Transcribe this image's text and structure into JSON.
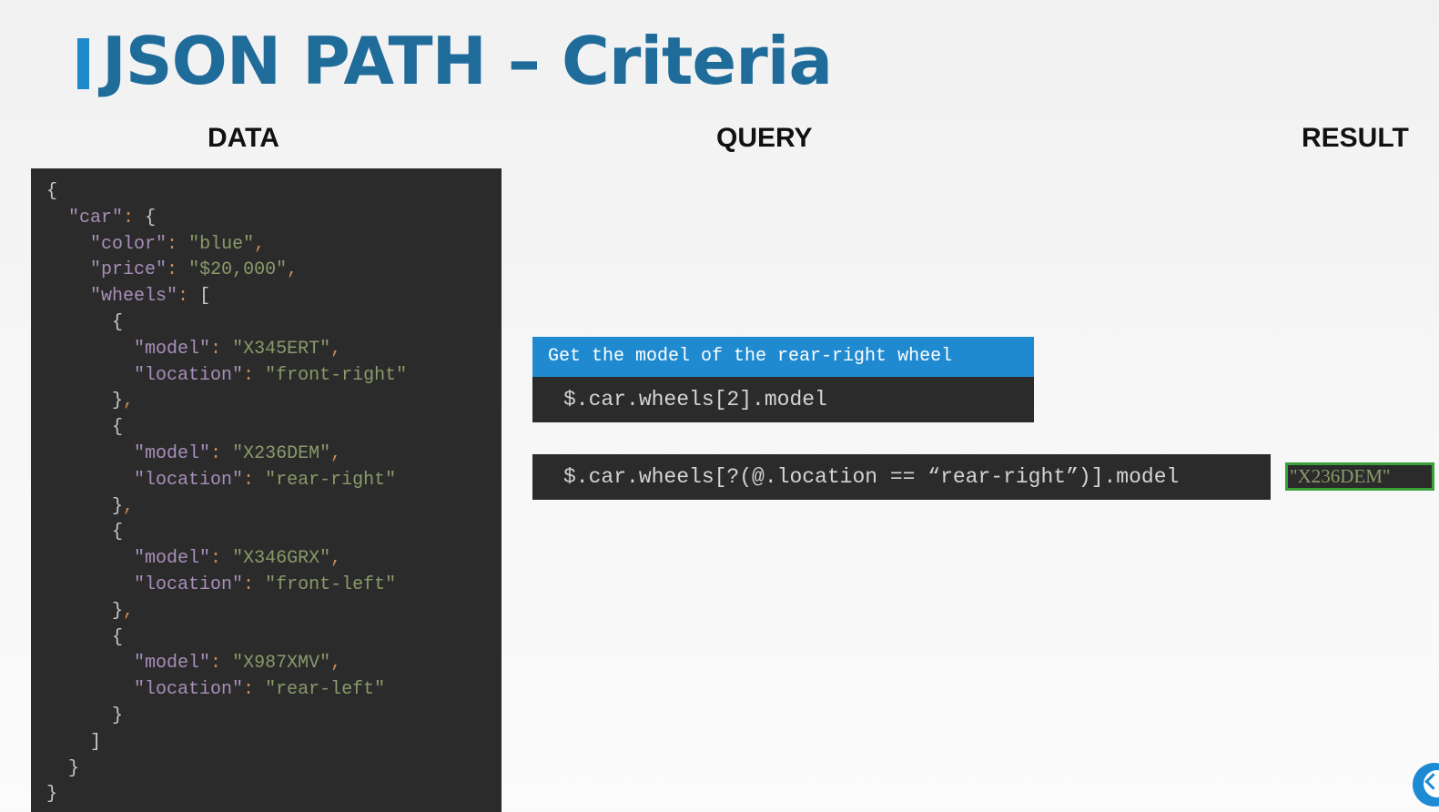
{
  "slide": {
    "title": "JSON PATH – Criteria",
    "columns": {
      "data": "DATA",
      "query": "QUERY",
      "result": "RESULT"
    }
  },
  "data_json": {
    "car_key": "\"car\"",
    "color_key": "\"color\"",
    "color_value": "\"blue\"",
    "price_key": "\"price\"",
    "price_value": "\"$20,000\"",
    "wheels_key": "\"wheels\"",
    "wheels": [
      {
        "model_key": "\"model\"",
        "model": "\"X345ERT\"",
        "location_key": "\"location\"",
        "location": "\"front-right\""
      },
      {
        "model_key": "\"model\"",
        "model": "\"X236DEM\"",
        "location_key": "\"location\"",
        "location": "\"rear-right\""
      },
      {
        "model_key": "\"model\"",
        "model": "\"X346GRX\"",
        "location_key": "\"location\"",
        "location": "\"front-left\""
      },
      {
        "model_key": "\"model\"",
        "model": "\"X987XMV\"",
        "location_key": "\"location\"",
        "location": "\"rear-left\""
      }
    ]
  },
  "query": {
    "question": "Get the model of the rear-right wheel",
    "code_index": "$.car.wheels[2].model",
    "code_filter": "$.car.wheels[?(@.location == “rear-right”)].model"
  },
  "result": {
    "value": "\"X236DEM\""
  },
  "colors": {
    "title": "#1f6c9b",
    "accent": "#1f8ac9",
    "code_bg": "#2b2b2b",
    "result_border": "#3aa13a",
    "json_key": "#a88fb9",
    "json_value": "#8a9a6a"
  },
  "icons": {
    "logo": "brand-logo-icon"
  }
}
